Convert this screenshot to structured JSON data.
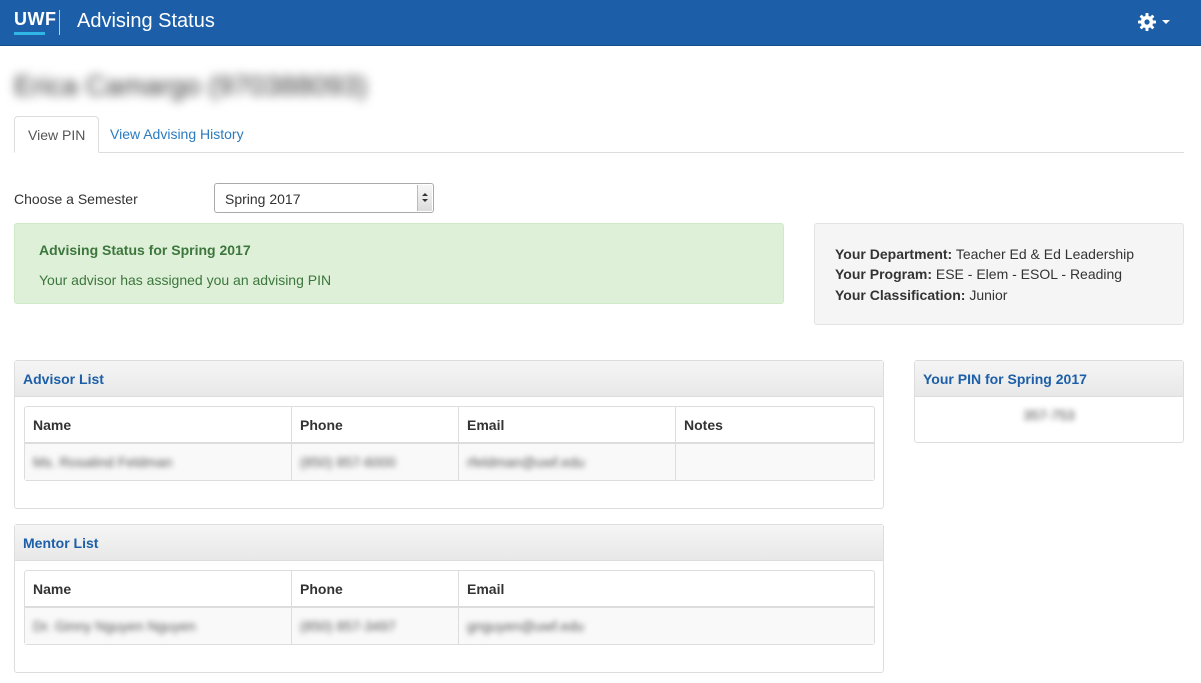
{
  "header": {
    "logo": "UWF",
    "app_title": "Advising Status",
    "settings_icon": "gear-icon"
  },
  "student": {
    "name": "Erica Camargo (970388093)"
  },
  "tabs": [
    {
      "label": "View PIN"
    },
    {
      "label": "View Advising History"
    }
  ],
  "semester": {
    "label": "Choose a Semester",
    "selected": "Spring 2017"
  },
  "status": {
    "title": "Advising Status for Spring 2017",
    "message": "Your advisor has assigned you an advising PIN"
  },
  "info": {
    "department_label": "Your Department:",
    "department": "Teacher Ed & Ed Leadership",
    "program_label": "Your Program:",
    "program": "ESE - Elem - ESOL - Reading",
    "classification_label": "Your Classification:",
    "classification": "Junior"
  },
  "advisor_list": {
    "title": "Advisor List",
    "columns": [
      "Name",
      "Phone",
      "Email",
      "Notes"
    ],
    "rows": [
      {
        "name": "Ms. Rosalind Feldman",
        "phone": "(850) 857-6000",
        "email": "rfeldman@uwf.edu",
        "notes": ""
      }
    ]
  },
  "mentor_list": {
    "title": "Mentor List",
    "columns": [
      "Name",
      "Phone",
      "Email"
    ],
    "rows": [
      {
        "name": "Dr. Ginny Nguyen Nguyen",
        "phone": "(850) 857-3497",
        "email": "gnguyen@uwf.edu"
      }
    ]
  },
  "pin": {
    "title": "Your PIN for Spring 2017",
    "value": "357-753"
  },
  "colors": {
    "brand_blue": "#1c5fa8",
    "success_bg": "#dff0d8",
    "success_text": "#3c763d",
    "link": "#2a7bc0"
  }
}
